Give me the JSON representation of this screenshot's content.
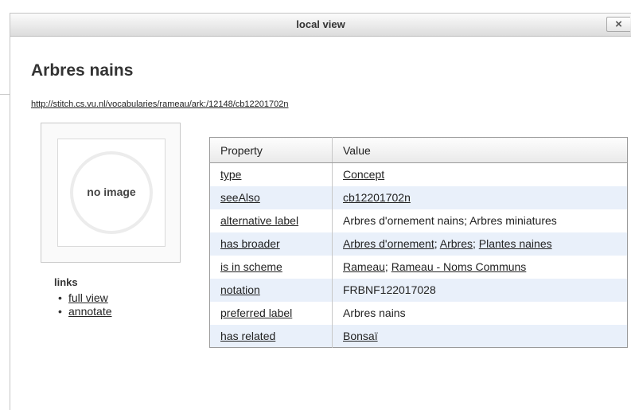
{
  "window": {
    "title": "local view",
    "close_label": "×"
  },
  "resource": {
    "title": "Arbres nains",
    "uri": "http://stitch.cs.vu.nl/vocabularies/rameau/ark:/12148/cb12201702n"
  },
  "image_placeholder": {
    "text": "no image"
  },
  "links": {
    "title": "links",
    "items": [
      "full view",
      "annotate"
    ]
  },
  "table": {
    "headers": [
      "Property",
      "Value"
    ],
    "rows": [
      {
        "property": "type",
        "values": [
          "Concept"
        ],
        "linked": true
      },
      {
        "property": "seeAlso",
        "values": [
          "cb12201702n"
        ],
        "linked": true
      },
      {
        "property": "alternative label",
        "values": [
          "Arbres d'ornement nains; Arbres miniatures"
        ],
        "linked": false
      },
      {
        "property": "has broader",
        "values": [
          "Arbres d'ornement",
          "Arbres",
          "Plantes naines"
        ],
        "linked": true
      },
      {
        "property": "is in scheme",
        "values": [
          "Rameau",
          "Rameau - Noms Communs"
        ],
        "linked": true
      },
      {
        "property": "notation",
        "values": [
          "FRBNF122017028"
        ],
        "linked": false
      },
      {
        "property": "preferred label",
        "values": [
          "Arbres nains"
        ],
        "linked": false
      },
      {
        "property": "has related",
        "values": [
          "Bonsaï"
        ],
        "linked": true
      }
    ]
  }
}
